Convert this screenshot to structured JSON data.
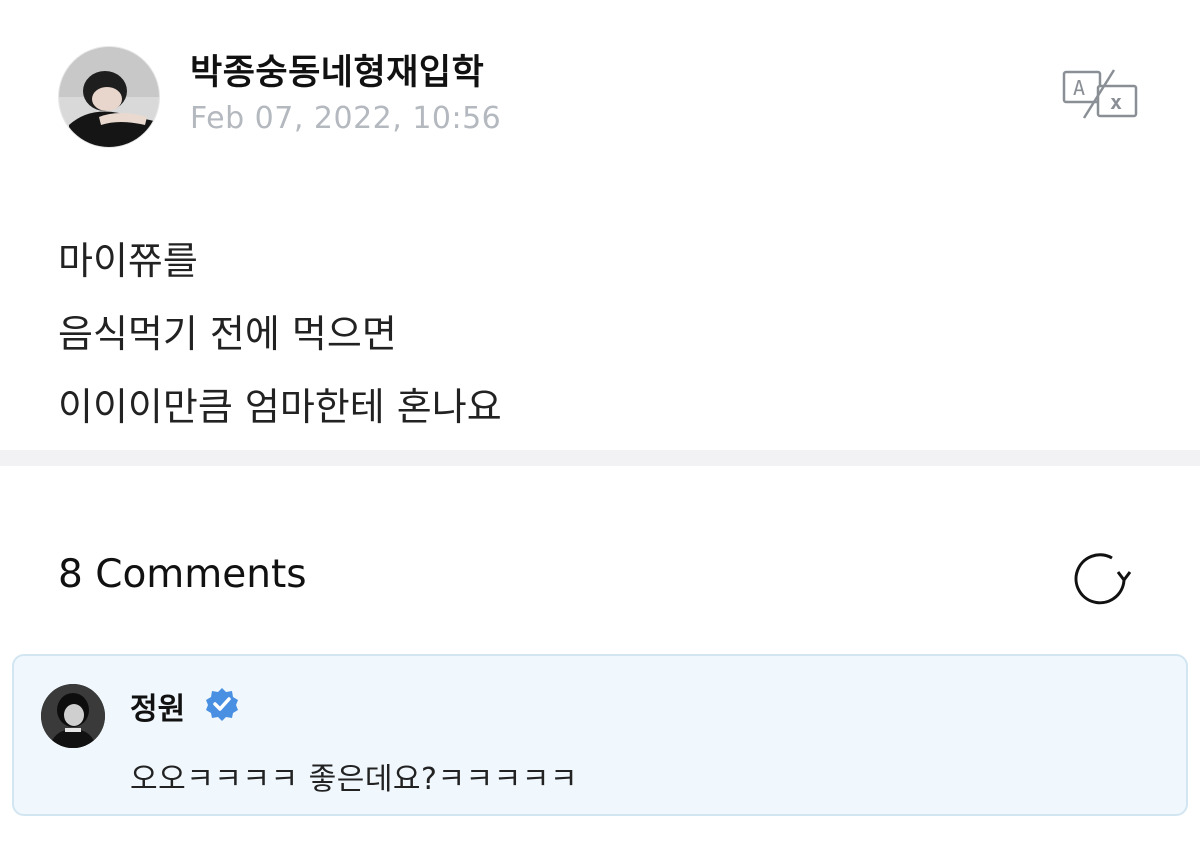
{
  "post": {
    "author": "박종숭동네형재입학",
    "date": "Feb 07, 2022, 10:56",
    "avatar_icon": "user-photo-avatar",
    "translate_icon": "translate-icon",
    "lines": [
      "마이쮸를",
      "음식먹기 전에 먹으면",
      "이이이만큼 엄마한테 혼나요"
    ]
  },
  "comments": {
    "header": "8 Comments",
    "refresh_icon": "refresh-icon",
    "items": [
      {
        "author": "정원",
        "verified": true,
        "text": "오오ㅋㅋㅋㅋ 좋은데요?ㅋㅋㅋㅋㅋ",
        "highlight_color": "#f0f8fd"
      }
    ]
  },
  "colors": {
    "verified_badge": "#4a90e2",
    "date_text": "#b4b8bf",
    "divider": "#f2f2f5",
    "comment_border": "#d2e6f2"
  }
}
